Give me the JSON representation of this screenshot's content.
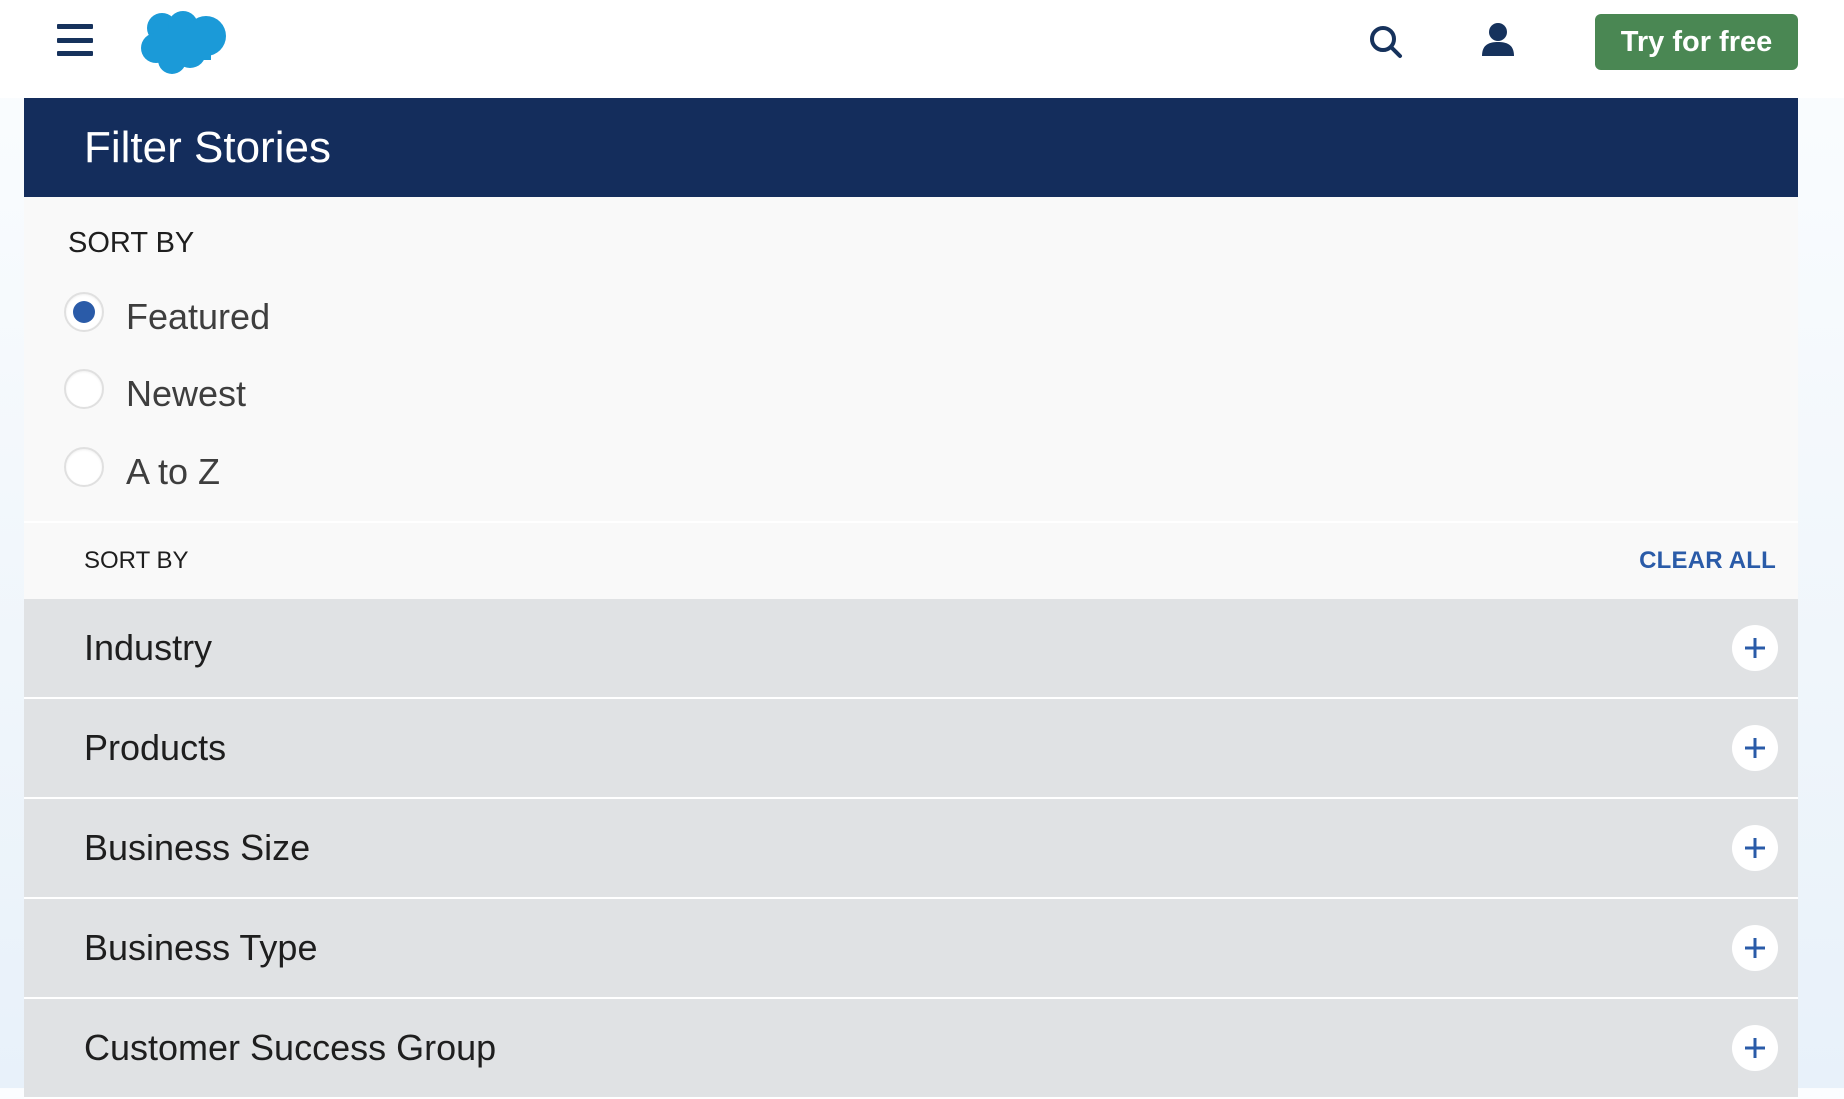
{
  "header": {
    "menu_icon": "hamburger-menu-icon",
    "logo": "salesforce-cloud-logo",
    "search_icon": "search-icon",
    "user_icon": "user-icon",
    "cta_label": "Try for free",
    "colors": {
      "cta": "#4a8753",
      "logo": "#1b9ad8",
      "icons": "#16325c"
    }
  },
  "panel": {
    "title": "Filter Stories",
    "title_bg": "#142d5c",
    "sort": {
      "label": "SORT BY",
      "options": [
        {
          "label": "Featured",
          "selected": true
        },
        {
          "label": "Newest",
          "selected": false
        },
        {
          "label": "A to Z",
          "selected": false
        }
      ],
      "accent": "#2a5ba8"
    },
    "filter_bar": {
      "label": "SORT BY",
      "clear_all": "CLEAR ALL"
    },
    "filters": [
      {
        "label": "Industry",
        "icon": "plus-icon"
      },
      {
        "label": "Products",
        "icon": "plus-icon"
      },
      {
        "label": "Business Size",
        "icon": "plus-icon"
      },
      {
        "label": "Business Type",
        "icon": "plus-icon"
      },
      {
        "label": "Customer Success Group",
        "icon": "plus-icon"
      }
    ]
  }
}
